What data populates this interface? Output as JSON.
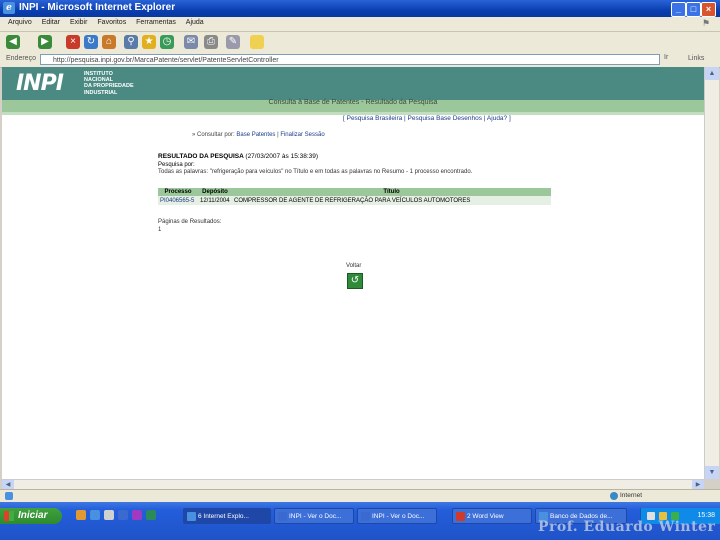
{
  "window": {
    "title": "INPI - Microsoft Internet Explorer"
  },
  "menu": [
    "Arquivo",
    "Editar",
    "Exibir",
    "Favoritos",
    "Ferramentas",
    "Ajuda"
  ],
  "address": {
    "label": "Endereço",
    "url": "http://pesquisa.inpi.gov.br/MarcaPatente/servlet/PatenteServletController",
    "go": "Ir",
    "links": "Links"
  },
  "page": {
    "logo": "INPI",
    "institute_lines": [
      "INSTITUTO",
      "NACIONAL",
      "DA PROPRIEDADE",
      "INDUSTRIAL"
    ],
    "heading": "Consulta à Base de Patentes - Resultado da Pesquisa",
    "top_links": "[ Pesquisa Brasileira | Pesquisa Base Desenhos | Ajuda? ]",
    "breadcrumb_prefix": "» Consultar por:",
    "breadcrumb_link1": "Base Patentes",
    "breadcrumb_sep": " | ",
    "breadcrumb_link2": "Finalizar Sessão",
    "result_title": "RESULTADO DA PESQUISA",
    "result_date": "(27/03/2007 às 15:38:39)",
    "searched_label": "Pesquisa por:",
    "searched_desc": "Todas as palavras: \"refrigeração para veículos\" no Título e em todas as palavras no Resumo - 1 processo encontrado.",
    "table": {
      "headers": [
        "Processo",
        "Depósito",
        "Título"
      ],
      "rows": [
        {
          "processo": "PI0406565-5",
          "deposito": "12/11/2004",
          "titulo": "COMPRESSOR DE AGENTE DE REFRIGERAÇÃO PARA VEÍCULOS AUTOMOTORES"
        }
      ]
    },
    "pages_label": "Páginas de Resultados:",
    "pages_value": "1",
    "back_label": "Voltar"
  },
  "status": {
    "zone": "Internet"
  },
  "taskbar": {
    "start": "Iniciar",
    "tasks": [
      "6 Internet Explo...",
      "INPI - Ver o Doc...",
      "INPI - Ver o Doc...",
      "2 Word View",
      "Banco de Dados de..."
    ],
    "clock": "15:38"
  },
  "credit": "Prof. Eduardo Winter"
}
